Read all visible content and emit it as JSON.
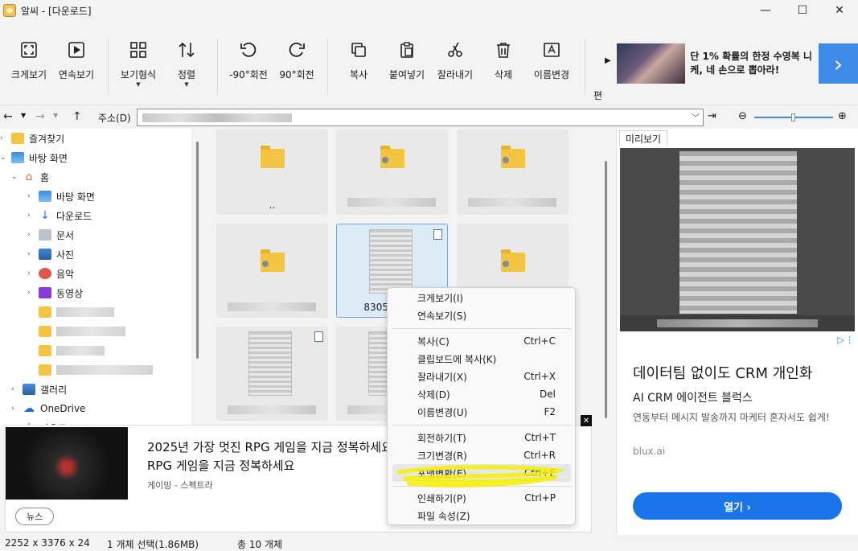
{
  "window": {
    "title": "알씨 - [다운로드]",
    "minimize": "—",
    "maximize": "☐",
    "close": "✕"
  },
  "toolbar": {
    "buttons": [
      {
        "label": "크게보기",
        "icon": "fullscreen-icon"
      },
      {
        "label": "연속보기",
        "icon": "play-icon"
      },
      {
        "label": "보기형식",
        "icon": "grid-icon"
      },
      {
        "label": "정렬",
        "icon": "sort-icon"
      },
      {
        "label": "-90°회전",
        "icon": "rotate-left-icon"
      },
      {
        "label": "90°회전",
        "icon": "rotate-right-icon"
      },
      {
        "label": "복사",
        "icon": "copy-icon"
      },
      {
        "label": "붙여넣기",
        "icon": "paste-icon"
      },
      {
        "label": "잘라내기",
        "icon": "scissors-icon"
      },
      {
        "label": "삭제",
        "icon": "trash-icon"
      },
      {
        "label": "이름변경",
        "icon": "rename-icon"
      }
    ],
    "overflow_label": "편",
    "ad_text": "단 1% 확률의 한정 수영복 니케, 네 손으로 뽑아라!"
  },
  "address": {
    "label": "주소(D)"
  },
  "tree": {
    "items": [
      {
        "label": "즐겨찾기"
      },
      {
        "label": "바탕 화면"
      },
      {
        "label": "홈"
      },
      {
        "label": "바탕 화면"
      },
      {
        "label": "다운로드"
      },
      {
        "label": "문서"
      },
      {
        "label": "사진"
      },
      {
        "label": "음악"
      },
      {
        "label": "동영상"
      },
      {
        "label": "갤러리"
      },
      {
        "label": "OneDrive"
      },
      {
        "label": "다운로드"
      }
    ]
  },
  "files": {
    "items": [
      {
        "label": ".."
      },
      {
        "label": "830528-"
      }
    ]
  },
  "preview": {
    "tab_label": "미리보기"
  },
  "ad_right": {
    "title": "데이터팀 없이도 CRM 개인화",
    "subtitle": "AI CRM 에이전트 블럭스",
    "description": "연동부터 메시지 발송까지 마케터 혼자서도 쉽게!",
    "brand": "blux.ai",
    "button_label": "열기 ›"
  },
  "ad_bottom": {
    "title": "2025년 가장 멋진 RPG 게임을 지금 정복하세요 멋진 RPG 게임을 지금 정복하세요",
    "source": "게이밍 - 스펙트라",
    "button_label": "뉴스",
    "close": "✕"
  },
  "context_menu": {
    "items": [
      {
        "label": "크게보기(I)",
        "shortcut": ""
      },
      {
        "label": "연속보기(S)",
        "shortcut": ""
      },
      {
        "label": "복사(C)",
        "shortcut": "Ctrl+C"
      },
      {
        "label": "클립보드에 복사(K)",
        "shortcut": ""
      },
      {
        "label": "잘라내기(X)",
        "shortcut": "Ctrl+X"
      },
      {
        "label": "삭제(D)",
        "shortcut": "Del"
      },
      {
        "label": "이름변경(U)",
        "shortcut": "F2"
      },
      {
        "label": "회전하기(T)",
        "shortcut": "Ctrl+T"
      },
      {
        "label": "크기변경(R)",
        "shortcut": "Ctrl+R"
      },
      {
        "label": "포맷변환(E)",
        "shortcut": "Ctrl+E"
      },
      {
        "label": "인쇄하기(P)",
        "shortcut": "Ctrl+P"
      },
      {
        "label": "파일 속성(Z)",
        "shortcut": ""
      }
    ],
    "highlight_color": "#f5f000"
  },
  "status": {
    "dimensions": "2252 x 3376 x 24",
    "selection": "1 개체 선택(1.86MB)",
    "total": "총 10 개체"
  }
}
